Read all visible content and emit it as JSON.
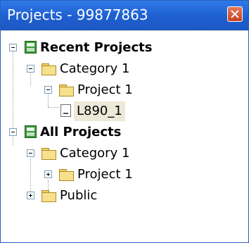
{
  "window": {
    "title": "Projects - 99877863"
  },
  "tree": {
    "recent": {
      "label": "Recent Projects",
      "category": {
        "label": "Category 1",
        "project": {
          "label": "Project 1",
          "file": {
            "label": "L890_1"
          }
        }
      }
    },
    "all": {
      "label": "All Projects",
      "category": {
        "label": "Category 1",
        "project": {
          "label": "Project 1"
        }
      },
      "public": {
        "label": "Public"
      }
    }
  },
  "icons": {
    "close": "close-icon",
    "database": "database-icon",
    "folder": "folder-icon",
    "file": "file-icon"
  },
  "colors": {
    "titlebar": "#1e5fcf",
    "close_button": "#c8401e",
    "database_icon": "#3c9a3c",
    "folder_icon": "#f6e08e"
  }
}
